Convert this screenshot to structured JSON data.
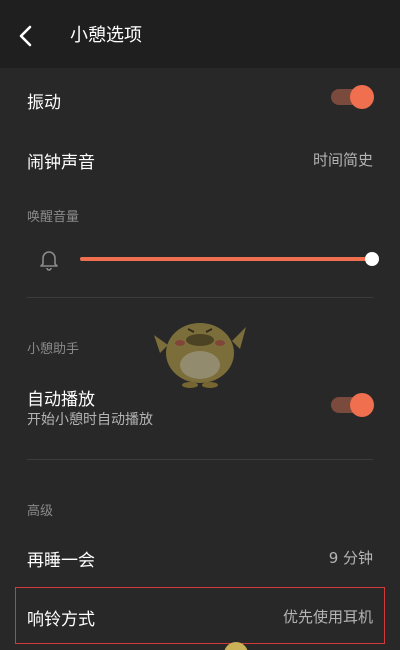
{
  "header": {
    "title": "小憩选项"
  },
  "settings": {
    "vibrate": {
      "label": "振动",
      "enabled": true
    },
    "alarm_sound": {
      "label": "闹钟声音",
      "value": "时间简史"
    },
    "wake_volume": {
      "heading": "唤醒音量",
      "level": 1.0
    },
    "assistant": {
      "heading": "小憩助手",
      "autoplay": {
        "label": "自动播放",
        "description": "开始小憩时自动播放",
        "enabled": true
      }
    },
    "advanced": {
      "heading": "高级",
      "snooze": {
        "label": "再睡一会",
        "value": "9 分钟"
      },
      "ring_mode": {
        "label": "响铃方式",
        "value": "优先使用耳机"
      }
    }
  },
  "colors": {
    "accent": "#f06f4f",
    "background": "#282828",
    "highlight_box": "#d23a3a"
  },
  "icons": {
    "back": "chevron-left-icon",
    "volume": "bell-icon"
  }
}
